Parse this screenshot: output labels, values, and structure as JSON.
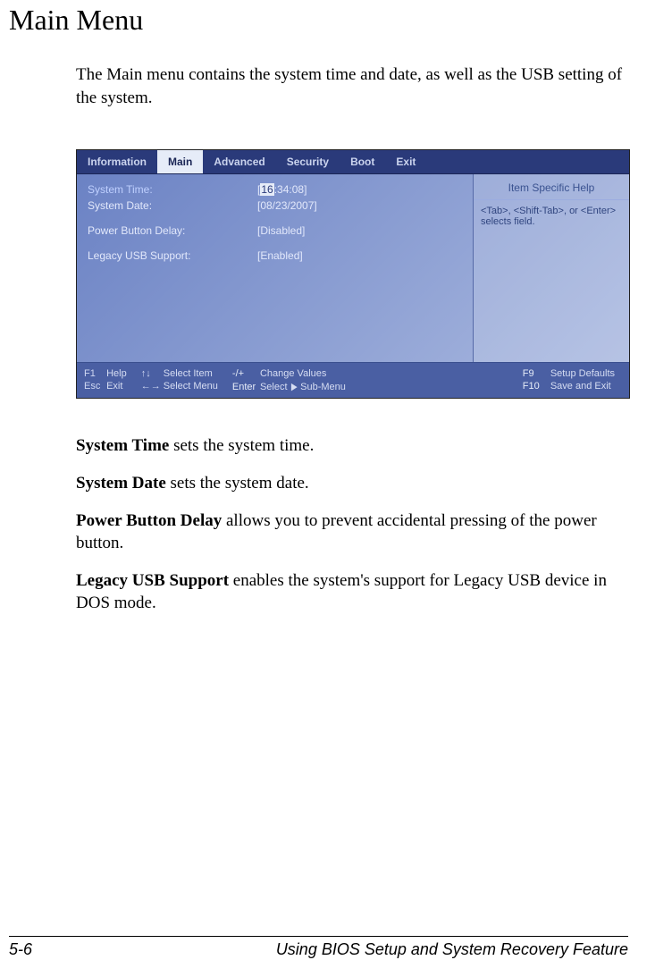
{
  "page": {
    "title": "Main Menu",
    "intro": "The Main menu contains the system time and date, as well as the USB setting of the system.",
    "footer_left": "5-6",
    "footer_right": "Using BIOS Setup and System Recovery Feature"
  },
  "bios": {
    "tabs": [
      "Information",
      "Main",
      "Advanced",
      "Security",
      "Boot",
      "Exit"
    ],
    "active_tab": "Main",
    "settings": [
      {
        "label": "System Time:",
        "value_pre": "[",
        "value_hl": "16",
        "value_post": ":34:08]"
      },
      {
        "label": "System Date:",
        "value": "[08/23/2007]"
      },
      {
        "gap": true
      },
      {
        "label": "Power Button Delay:",
        "value": "[Disabled]"
      },
      {
        "gap": true
      },
      {
        "label": "Legacy USB Support:",
        "value": "[Enabled]"
      }
    ],
    "help": {
      "title": "Item Specific Help",
      "body": "<Tab>, <Shift-Tab>, or <Enter> selects field."
    },
    "footer": {
      "f1": "F1",
      "f1_label": "Help",
      "esc": "Esc",
      "esc_label": "Exit",
      "arrows_v": "↑↓",
      "arrows_v_label": "Select Item",
      "arrows_h": "←→",
      "arrows_h_label": "Select Menu",
      "pm": "-/+",
      "pm_label": "Change Values",
      "enter": "Enter",
      "enter_label_a": "Select",
      "enter_label_b": "Sub-Menu",
      "f9": "F9",
      "f9_label": "Setup Defaults",
      "f10": "F10",
      "f10_label": "Save and Exit"
    }
  },
  "definitions": [
    {
      "term": "System Time",
      "desc": "  sets the system time."
    },
    {
      "term": "System Date",
      "desc": "  sets the system date."
    },
    {
      "term": "Power Button Delay",
      "desc": "  allows you to prevent accidental pressing of the power button."
    },
    {
      "term": "Legacy USB Support",
      "desc": "  enables the system's support for Legacy USB device in DOS mode."
    }
  ]
}
